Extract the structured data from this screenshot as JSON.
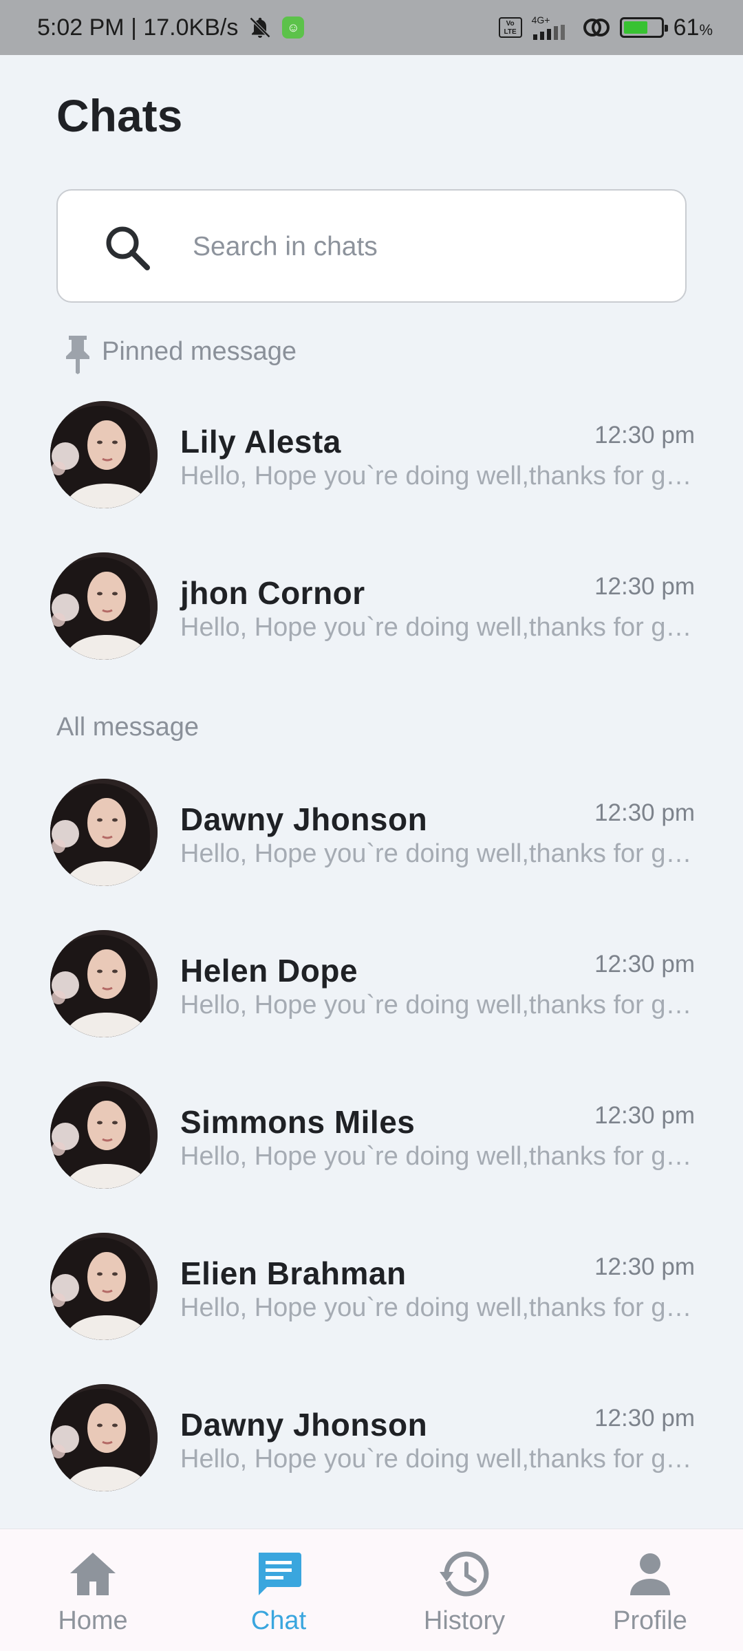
{
  "status_bar": {
    "time_speed": "5:02 PM | 17.0KB/s",
    "network": "4G+",
    "volte": "Vo LTE",
    "battery_pct": "61",
    "battery_sign": "%"
  },
  "page": {
    "title": "Chats"
  },
  "search": {
    "placeholder": "Search in chats",
    "value": ""
  },
  "pinned": {
    "label": "Pinned message",
    "chats": [
      {
        "name": "Lily Alesta",
        "time": "12:30 pm",
        "preview": "Hello, Hope you`re doing well,thanks for getting back to me"
      },
      {
        "name": "jhon Cornor",
        "time": "12:30 pm",
        "preview": "Hello, Hope you`re doing well,thanks for getting back to me"
      }
    ]
  },
  "all": {
    "label": "All message",
    "chats": [
      {
        "name": "Dawny Jhonson",
        "time": "12:30 pm",
        "preview": "Hello, Hope you`re doing well,thanks for getting back to me"
      },
      {
        "name": "Helen Dope",
        "time": "12:30 pm",
        "preview": "Hello, Hope you`re doing well,thanks for getting back to me"
      },
      {
        "name": "Simmons Miles",
        "time": "12:30 pm",
        "preview": "Hello, Hope you`re doing well,thanks for getting back to me"
      },
      {
        "name": "Elien Brahman",
        "time": "12:30 pm",
        "preview": "Hello, Hope you`re doing well,thanks for getting back to me"
      },
      {
        "name": "Dawny Jhonson",
        "time": "12:30 pm",
        "preview": "Hello, Hope you`re doing well,thanks for getting back to me"
      }
    ]
  },
  "nav": {
    "items": [
      {
        "label": "Home",
        "icon": "home-icon"
      },
      {
        "label": "Chat",
        "icon": "chat-icon",
        "active": true
      },
      {
        "label": "History",
        "icon": "history-icon"
      },
      {
        "label": "Profile",
        "icon": "profile-icon"
      }
    ]
  },
  "colors": {
    "background": "#eff3f7",
    "accent": "#3aa6de",
    "status_bar": "#a9abae",
    "text_primary": "#1f2125",
    "text_muted": "#a5abb3"
  }
}
